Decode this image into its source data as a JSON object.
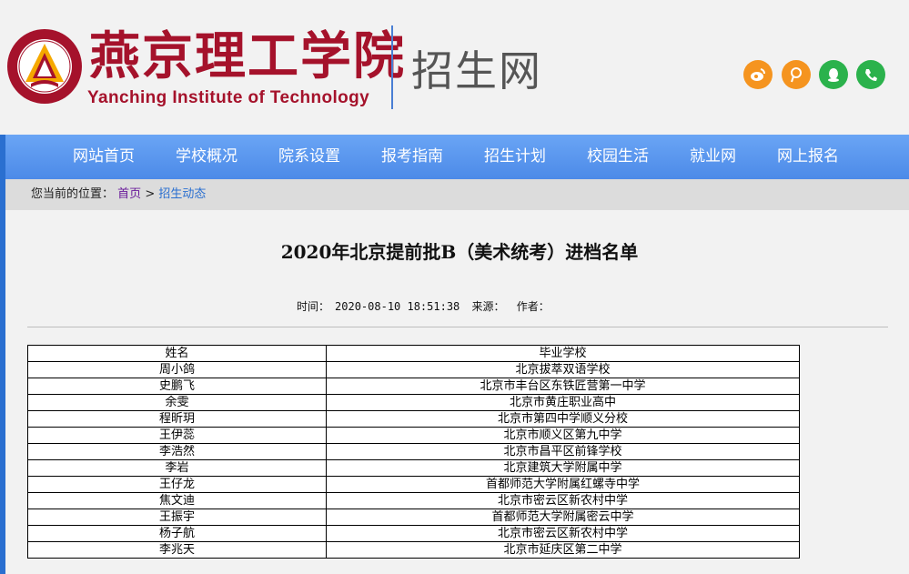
{
  "header": {
    "school_name_cn": "燕京理工学院",
    "school_name_en": "Yanching Institute of Technology",
    "site_name": "招生网",
    "seal_text": "燕京理工学院 YANCHING INSTITUTE OF TECHNOLOGY",
    "social_icons": [
      "weibo-icon",
      "tencent-weibo-icon",
      "qq-icon",
      "wechat-icon"
    ]
  },
  "nav": {
    "items": [
      "网站首页",
      "学校概况",
      "院系设置",
      "报考指南",
      "招生计划",
      "校园生活",
      "就业网",
      "网上报名"
    ]
  },
  "breadcrumb": {
    "prefix": "您当前的位置：",
    "home": "首页",
    "separator": ">",
    "current": "招生动态"
  },
  "article": {
    "title": "2020年北京提前批B（美术统考）进档名单",
    "time_label": "时间：",
    "time_value": "2020-08-10 18:51:38",
    "source_label": "来源：",
    "author_label": "作者："
  },
  "table": {
    "headers": [
      "姓名",
      "毕业学校"
    ],
    "rows": [
      [
        "周小鸽",
        "北京拔萃双语学校"
      ],
      [
        "史鹏飞",
        "北京市丰台区东铁匠营第一中学"
      ],
      [
        "余雯",
        "北京市黄庄职业高中"
      ],
      [
        "程昕玥",
        "北京市第四中学顺义分校"
      ],
      [
        "王伊蕊",
        "北京市顺义区第九中学"
      ],
      [
        "李浩然",
        "北京市昌平区前锋学校"
      ],
      [
        "李岩",
        "北京建筑大学附属中学"
      ],
      [
        "王仔龙",
        "首都师范大学附属红螺寺中学"
      ],
      [
        "焦文迪",
        "北京市密云区新农村中学"
      ],
      [
        "王振宇",
        "首都师范大学附属密云中学"
      ],
      [
        "杨子航",
        "北京市密云区新农村中学"
      ],
      [
        "李兆天",
        "北京市延庆区第二中学"
      ]
    ]
  },
  "colors": {
    "brand_red": "#a5122b",
    "nav_blue": "#4c8ae8",
    "accent_blue": "#2a6fd0"
  }
}
